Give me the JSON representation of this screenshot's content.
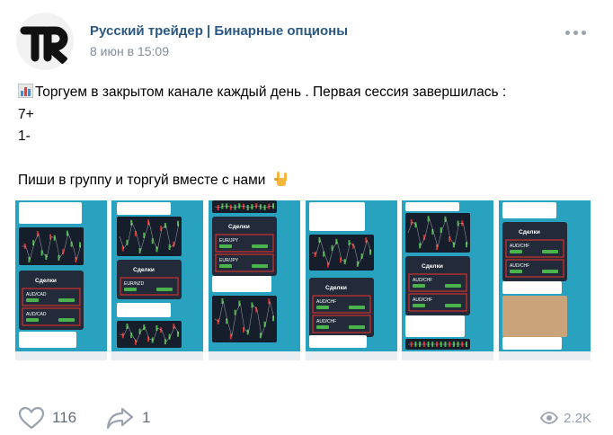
{
  "post": {
    "author": "Русский трейдер | Бинарные опционы",
    "date": "8 июн в 15:09",
    "text_lines": [
      "Торгуем в закрытом канале каждый день . Первая сессия завершилась :",
      "7+",
      "1-",
      "",
      "Пиши в группу и торгуй вместе с нами"
    ],
    "emoji": {
      "first_line": "bar-chart-emoji",
      "last_line": "rock-on-hand-emoji"
    }
  },
  "gallery": {
    "images": [
      {
        "name": "screenshot-1",
        "deals_title": "Сделки",
        "pairs": [
          "AUD/CAD",
          "AUD/CAD"
        ]
      },
      {
        "name": "screenshot-2",
        "deals_title": "Сделки",
        "pairs": [
          "EUR/NZD"
        ]
      },
      {
        "name": "screenshot-3",
        "deals_title": "Сделки",
        "pairs": [
          "EUR/JPY",
          "EUR/JPY"
        ]
      },
      {
        "name": "screenshot-4",
        "deals_title": "Сделки",
        "pairs": [
          "AUD/CHF",
          "AUD/CHF"
        ]
      },
      {
        "name": "screenshot-5",
        "deals_title": "Сделки",
        "pairs": [
          "AUD/CHF",
          "AUD/CHF"
        ]
      },
      {
        "name": "screenshot-6",
        "deals_title": "Сделки",
        "pairs": [
          "AUD/CHF",
          "AUD/CHF"
        ]
      }
    ]
  },
  "footer": {
    "likes": "116",
    "shares": "1",
    "views": "2.2K"
  },
  "colors": {
    "author_link": "#2a5885",
    "muted": "#818c99",
    "icon_gray": "#99a2ad",
    "deal_red": "#d0312d",
    "profit_green": "#4bb34b",
    "sea_blue": "#1d8fb3"
  }
}
